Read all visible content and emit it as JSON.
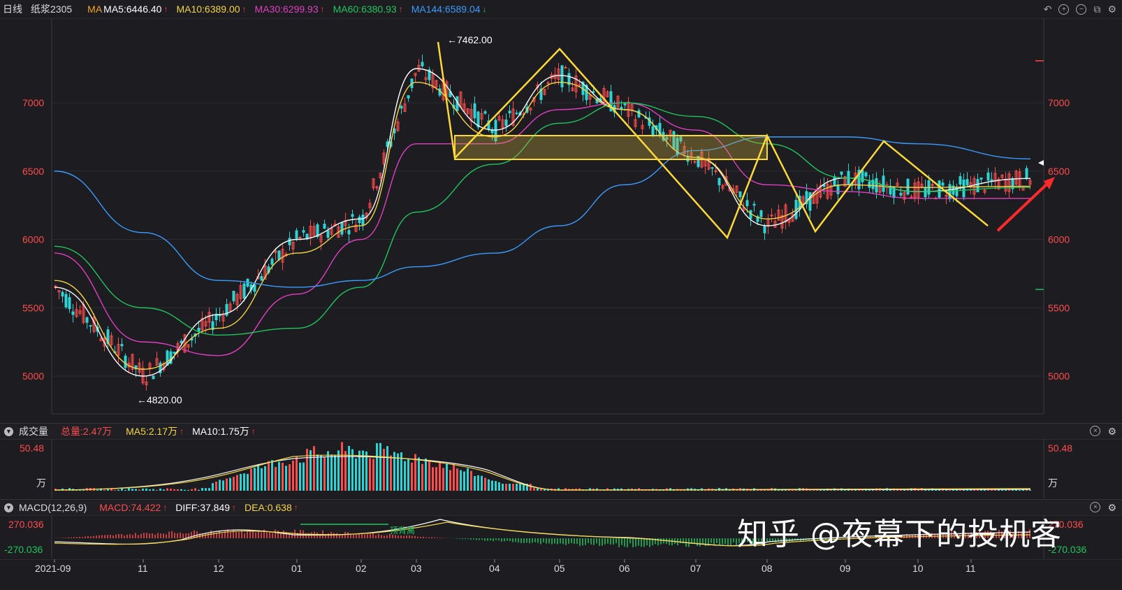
{
  "header": {
    "period": "日线",
    "symbol": "纸浆2305",
    "ma_label": "MA",
    "ma5": "MA5:6446.40",
    "ma10": "MA10:6389.00",
    "ma30": "MA30:6299.93",
    "ma60": "MA60:6380.93",
    "ma144": "MA144:6589.04"
  },
  "tools": [
    "undo-icon",
    "zoom-in-icon",
    "zoom-out-icon",
    "layout-icon",
    "settings-icon"
  ],
  "main_chart": {
    "y_ticks": [
      "7000",
      "6500",
      "6000",
      "5500",
      "5000"
    ],
    "high_label": "←7462.00",
    "low_label": "←4820.00",
    "current_price": 6589.04
  },
  "volume_panel": {
    "title": "成交量",
    "total": "总量:2.47万",
    "ma5": "MA5:2.17万",
    "ma10": "MA10:1.75万",
    "top_value": "50.48",
    "unit": "万"
  },
  "macd_panel": {
    "title": "MACD(12,26,9)",
    "macd": "MACD:74.422",
    "diff": "DIFF:37.849",
    "dea": "DEA:0.638",
    "top_value": "270.036",
    "bottom_value": "-270.036",
    "right_top": "270.036",
    "right_bottom": "-270.036",
    "annotation": "顶背离"
  },
  "x_axis": [
    "2021-09",
    "11",
    "12",
    "01",
    "02",
    "03",
    "04",
    "05",
    "06",
    "07",
    "08",
    "09",
    "10",
    "11"
  ],
  "watermark": "知乎 @夜幕下的投机客",
  "colors": {
    "ma5": "#ffffff",
    "ma10": "#f5d547",
    "ma30": "#e040c0",
    "ma60": "#22c55e",
    "ma144": "#3b9cff",
    "up": "#ff4d4d",
    "down": "#2ed3d3",
    "pattern": "#ffd83a"
  },
  "chart_data": {
    "type": "line",
    "title": "",
    "x": [
      "2021-09",
      "11",
      "12",
      "01",
      "02",
      "03",
      "04",
      "05",
      "06",
      "07",
      "08",
      "09",
      "10",
      "11"
    ],
    "series": [
      {
        "name": "MA5",
        "values": [
          5650,
          5000,
          5450,
          6000,
          6150,
          7250,
          6800,
          7200,
          6950,
          6600,
          6100,
          6450,
          6350,
          6446
        ]
      },
      {
        "name": "MA10",
        "values": [
          5700,
          5050,
          5350,
          5900,
          6100,
          7150,
          6750,
          7150,
          6950,
          6600,
          6150,
          6400,
          6380,
          6389
        ]
      },
      {
        "name": "MA30",
        "values": [
          5900,
          5250,
          5150,
          5600,
          6000,
          6700,
          6700,
          6950,
          7000,
          6800,
          6400,
          6350,
          6300,
          6300
        ]
      },
      {
        "name": "MA60",
        "values": [
          5950,
          5500,
          5300,
          5350,
          5650,
          6200,
          6550,
          6850,
          7000,
          6900,
          6700,
          6450,
          6350,
          6381
        ]
      },
      {
        "name": "MA144",
        "values": [
          6500,
          6050,
          5700,
          5650,
          5700,
          5800,
          5900,
          6100,
          6400,
          6650,
          6750,
          6750,
          6700,
          6589
        ]
      }
    ],
    "ylim": [
      4700,
      7550
    ],
    "high": 7462.0,
    "low": 4820.0
  }
}
